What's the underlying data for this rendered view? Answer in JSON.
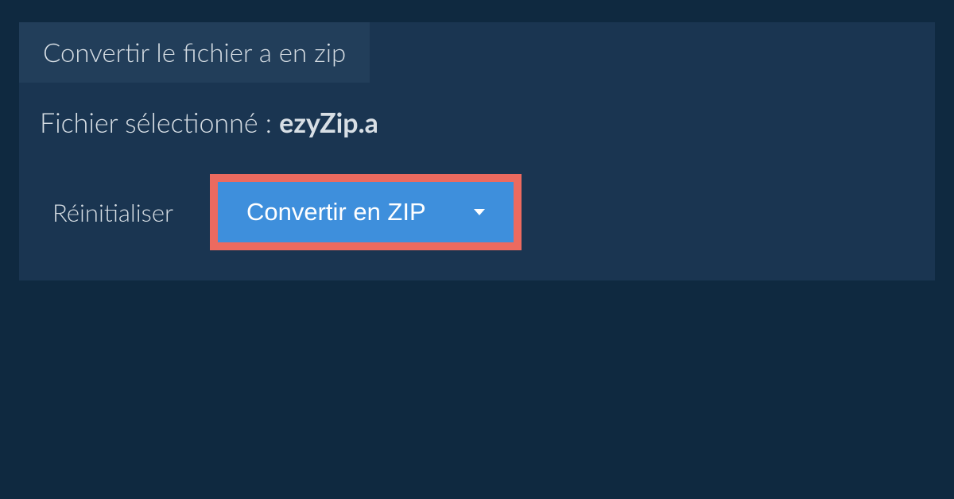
{
  "tab": {
    "label": "Convertir le fichier a en zip"
  },
  "selected": {
    "prefix": "Fichier sélectionné : ",
    "filename": "ezyZip.a"
  },
  "actions": {
    "reset_label": "Réinitialiser",
    "convert_label": "Convertir en ZIP"
  },
  "colors": {
    "background": "#0f2940",
    "panel": "#1a3551",
    "tab": "#223e5a",
    "button": "#3e8fdc",
    "highlight": "#ec6a5f"
  }
}
